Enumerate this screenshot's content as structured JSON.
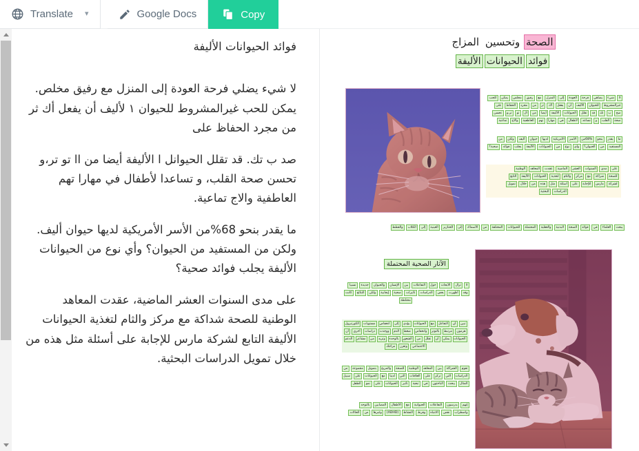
{
  "toolbar": {
    "translate_label": "Translate",
    "translate_caret": "▾",
    "google_docs_label": "Google Docs",
    "copy_label": "Copy",
    "icons": {
      "globe": "globe-icon",
      "pencil": "pencil-icon",
      "copy": "copy-icon"
    },
    "colors": {
      "primary": "#21cf9a",
      "button_text": "#5b6a78"
    }
  },
  "source_pane": {
    "paragraphs": [
      "فوائد الحيوانات الأليفة",
      "لا شيء يضلي فرحة العودة إلى المنزل مع رفيق مخلص. يمكن للحب غيرالمشروط للحيوان ١ لأليف أن يفعل أك ثر من مجرد الحفاظ على",
      "صد ب تك. قد تقلل الحيوانل ا الأليفة أيضا من اا تو تر،و تحسن صحة القلب، و تساعدا لأطفال في مهارا تهم العاطفية والاج تماعية.",
      "ما يقدر بنحو 68%من الأسر الأمريكية لديها حيوان أليف. ولكن من المستفيد من الحيوان؟ وأي نوع من الحيوانات الأليفة يجلب فوائد صحية؟",
      "على مدى السنوات العشر الماضية، عقدت المعاهد الوطنية للصحة شداكة مع مركز والثام لتغذية الحيوانات الأليفة التابع لشركة مارس للإجابة على أسئلة مثل هذه من خلال تمويل الدراسات البحثية."
    ]
  },
  "document_preview": {
    "title_parts": [
      {
        "text": "الصحة",
        "highlight": "pink"
      },
      {
        "text": "وتحسين",
        "highlight": "pink"
      },
      {
        "text": "المزاج",
        "highlight": "none"
      }
    ],
    "subtitle_parts": [
      {
        "text": "فوائد",
        "highlight": "green"
      },
      {
        "text": "الحيوانات",
        "highlight": "green"
      },
      {
        "text": "الأليفة",
        "highlight": "green"
      }
    ],
    "section_heading": "الآثار الصحية المحتملة",
    "blocks": [
      {
        "id": "block-intro",
        "background": "none",
        "rows": [
          [
            "لا",
            "شيء",
            "يضاهي",
            "فرحة",
            "العودة",
            "إلى",
            "المنزل",
            "مع",
            "رفيق",
            "مخلص",
            "يمكن",
            "للحب"
          ],
          [
            "غيرالمشروط",
            "للحيوان",
            "الأليف",
            "أن",
            "يفعل",
            "أك",
            "ثر",
            "من",
            "مجرد",
            "الحفاظ",
            "على"
          ],
          [
            "صح",
            "ب",
            "تك",
            "قد",
            "تقلل",
            "الحيوانات",
            "الأليفة",
            "أيضا",
            "من",
            "ال",
            "تو",
            "تر،و",
            "تحسن"
          ],
          [
            "صحة",
            "القلب",
            "و",
            "تساعد",
            "لأطفال",
            "في",
            "مهارا",
            "تهم",
            "العاطفية",
            "والاج",
            "تماعية"
          ]
        ]
      },
      {
        "id": "block-stat",
        "background": "none",
        "rows": [
          [
            "ما",
            "يقدر",
            "بنحو",
            "68%من",
            "الأسر",
            "الأمريكية",
            "لديها",
            "حيوان",
            "أليف",
            "ولكن",
            "من"
          ],
          [
            "المستفيد",
            "من",
            "الحيوان؟",
            "وأي",
            "نوع",
            "من",
            "الحيوانات",
            "الأليفة",
            "يجلب",
            "فوائد",
            "صحية؟"
          ]
        ]
      },
      {
        "id": "block-institutes",
        "background": "cream",
        "rows": [
          [
            "على",
            "مدى",
            "السنوات",
            "العشر",
            "الماضية",
            "عقدت",
            "المعاهد",
            "الوطنية"
          ],
          [
            "للصحة",
            "شراكة",
            "مع",
            "مركز",
            "والثام",
            "لتغذية",
            "الحيوانات",
            "الأليفة",
            "التابع"
          ],
          [
            "لشركة",
            "مارس",
            "للإجابة",
            "على",
            "أسئلة",
            "مثل",
            "هذه",
            "من",
            "خلال",
            "تمويل"
          ],
          [
            "الدراسات",
            "البحثية"
          ]
        ]
      },
      {
        "id": "block-wide-note",
        "background": "none",
        "rows": [
          [
            "يبحث",
            "العلماء",
            "في",
            "فوائد",
            "الصحة",
            "البدنية",
            "والعقلية",
            "المحتملة",
            "للحيوانات",
            "المختلفة",
            "من",
            "الأسماك",
            "إلى",
            "الخنازير",
            "الغينية",
            "إلى",
            "الكلاب",
            "والقطط"
          ]
        ]
      },
      {
        "id": "block-interactions",
        "background": "none",
        "rows": [
          [
            "لا",
            "تزال",
            "الأبحاث",
            "حول",
            "التفاعلات",
            "بين",
            "الإنسان",
            "والحيوان",
            "جديدة",
            "نسبيا"
          ],
          [
            "وقد",
            "أظهرت",
            "بعض",
            "الدراسات",
            "تأثيرات",
            "صحية",
            "إيجابية",
            "ولكن",
            "النتائج",
            "كانت"
          ],
          [
            "مختلطة"
          ]
        ]
      },
      {
        "id": "block-cortisol",
        "background": "mint",
        "rows": [
          [
            "تبين",
            "أن",
            "التفاعل",
            "مع",
            "الحيوانات",
            "يؤدي",
            "إلى",
            "انخفاض",
            "مستويات",
            "الكورتيزول"
          ],
          [
            "هرمون",
            "مرتبط",
            "بالتوتر",
            "وانخفاض",
            "ضغط",
            "الدم",
            "ووجدت",
            "دراسات",
            "أخرى",
            "أن"
          ],
          [
            "الحيوانات",
            "يمكن",
            "أن",
            "تقلل",
            "من",
            "الشعور",
            "بالوحدة",
            "وتزيد",
            "من",
            "مشاعر",
            "الدعم"
          ],
          [
            "الاجتماعي",
            "وتعزز",
            "مزاجك"
          ]
        ]
      },
      {
        "id": "block-partnership",
        "background": "none",
        "rows": [
          [
            "تقوم",
            "الشراكة",
            "بين",
            "المعاهد",
            "الوطنية",
            "للصحة",
            "والمريخ",
            "بتمويل",
            "مجموعة",
            "من"
          ],
          [
            "الدراسات",
            "التي",
            "تركز",
            "على",
            "العلاقات",
            "التي",
            "لدينا",
            "مع",
            "الحيوانات",
            "على",
            "سبيل"
          ],
          [
            "المثال",
            "يبحث",
            "الباحثون",
            "في",
            "تبعية",
            "تأثير",
            "الحيوانات",
            "على",
            "نمو",
            "الطفل"
          ]
        ]
      },
      {
        "id": "block-autism",
        "background": "none",
        "rows": [
          [
            "إنهم",
            "يدرسون",
            "التفاعلات",
            "الحيوانية",
            "مع",
            "الأطفال",
            "المصابين",
            "بالتوحد"
          ],
          [
            "واضطراب",
            "نقص",
            "الانتباه",
            "وفرط",
            "النشاط",
            "(ADHD)",
            "وغيرها",
            "من",
            "الحالات"
          ]
        ]
      }
    ],
    "images": [
      {
        "id": "cat-photo",
        "alt": "tabby cat against blue sky"
      },
      {
        "id": "dog-kitten-photo",
        "alt": "dog and tabby kitten resting together"
      }
    ]
  },
  "colors": {
    "highlight_pink": "#f9b6d4",
    "highlight_pink_border": "#e46fa6",
    "highlight_green": "#d8f2cd",
    "highlight_green_border": "#63b446",
    "cream_background": "#fdf8e6",
    "mint_background": "#eaf7e4",
    "accent_teal": "#21cf9a"
  }
}
